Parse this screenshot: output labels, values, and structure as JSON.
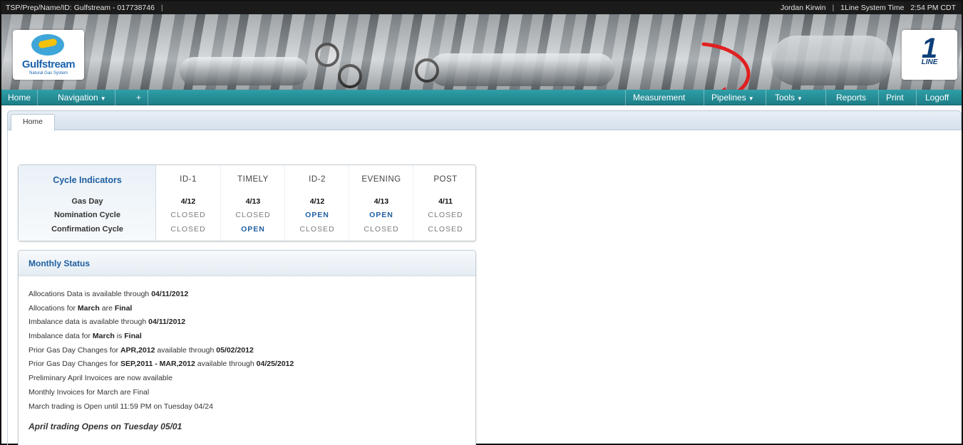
{
  "topbar": {
    "context": "TSP/Prep/Name/ID: Gulfstream - 017738746",
    "context_sep": "|",
    "user": "Jordan Kirwin",
    "sep": "|",
    "time_label": "1Line System Time",
    "time_value": "2:54 PM CDT"
  },
  "brand": {
    "name": "Gulfstream",
    "sub": "Natural Gas System",
    "oneline_number": "1",
    "oneline_word": "LINE",
    "accent": "#1d7e87",
    "arrow_color": "#e02020"
  },
  "nav": {
    "home": "Home",
    "navigation": "Navigation",
    "plus": "+",
    "measurement": "Measurement",
    "pipelines": "Pipelines",
    "tools": "Tools",
    "reports": "Reports",
    "print": "Print",
    "logoff": "Logoff"
  },
  "tabs": {
    "home": "Home"
  },
  "cycle": {
    "title": "Cycle Indicators",
    "row_labels": {
      "gas_day": "Gas Day",
      "nomination": "Nomination Cycle",
      "confirmation": "Confirmation Cycle"
    },
    "columns": [
      {
        "name": "ID-1",
        "gas_day": "4/12",
        "nomination": "CLOSED",
        "confirmation": "CLOSED"
      },
      {
        "name": "TIMELY",
        "gas_day": "4/13",
        "nomination": "CLOSED",
        "confirmation": "OPEN"
      },
      {
        "name": "ID-2",
        "gas_day": "4/12",
        "nomination": "OPEN",
        "confirmation": "CLOSED"
      },
      {
        "name": "EVENING",
        "gas_day": "4/13",
        "nomination": "OPEN",
        "confirmation": "CLOSED"
      },
      {
        "name": "POST",
        "gas_day": "4/11",
        "nomination": "CLOSED",
        "confirmation": "CLOSED"
      }
    ]
  },
  "monthly": {
    "title": "Monthly Status",
    "lines": [
      {
        "a": "Allocations Data is available through ",
        "b": "04/11/2012",
        "c": "",
        "d": "",
        "e": ""
      },
      {
        "a": "Allocations for ",
        "b": "March",
        "c": " are ",
        "d": "Final",
        "e": ""
      },
      {
        "a": "Imbalance data is available through ",
        "b": "04/11/2012",
        "c": "",
        "d": "",
        "e": ""
      },
      {
        "a": "Imbalance data for ",
        "b": "March",
        "c": " is ",
        "d": "Final",
        "e": ""
      },
      {
        "a": "Prior Gas Day Changes for ",
        "b": "APR,2012",
        "c": " available through ",
        "d": "05/02/2012",
        "e": ""
      },
      {
        "a": "Prior Gas Day Changes for ",
        "b": "SEP,2011 - MAR,2012",
        "c": " available through ",
        "d": "04/25/2012",
        "e": ""
      },
      {
        "a": "Preliminary April Invoices are now available",
        "b": "",
        "c": "",
        "d": "",
        "e": ""
      },
      {
        "a": "Monthly Invoices for March are Final",
        "b": "",
        "c": "",
        "d": "",
        "e": ""
      },
      {
        "a": "March trading is Open until 11:59 PM on Tuesday 04/24",
        "b": "",
        "c": "",
        "d": "",
        "e": ""
      }
    ],
    "highlight": "April trading Opens on Tuesday 05/01"
  }
}
